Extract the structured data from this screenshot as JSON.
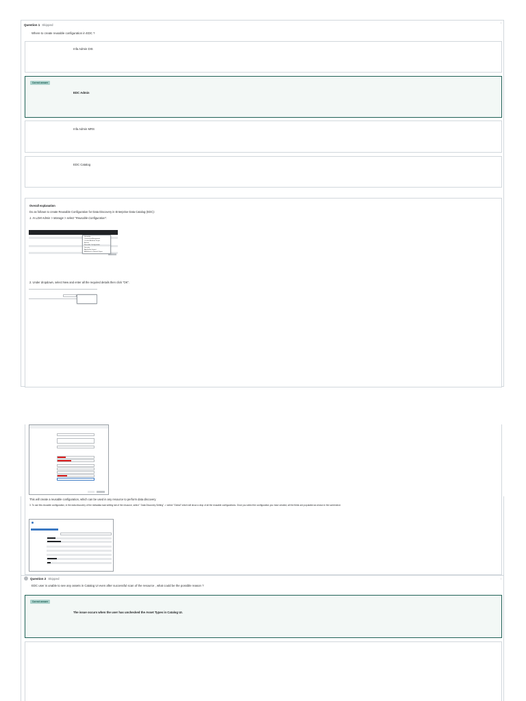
{
  "question1": {
    "number_label": "Question 1",
    "status": "Skipped",
    "text": "Where to create reusable configuration in EDC ?",
    "answers": [
      {
        "text": "Infa Admin DIS",
        "correct": false
      },
      {
        "text": "EDC Admin",
        "correct": true
      },
      {
        "text": "Infa Admin MRS",
        "correct": false
      },
      {
        "text": "EDC Catalog",
        "correct": false
      }
    ],
    "correct_badge": "Correct answer"
  },
  "explanation": {
    "heading": "Overall explanation",
    "line1": "Do as follows to create Reusable Configuration for Data Discovery in Enterprise Data Catalog (EDC):",
    "line2": "1. In LDM Admin > Manage > select \"Reusable Configuration\".",
    "step2": "2. Under dropdown, select New and enter all the required details then click \"OK\".",
    "menu_items": [
      "Schedule",
      "Connection Assignment",
      "Custom Attribute Scope",
      "Actions",
      "Reusable Configuration",
      "Security",
      "Application Import",
      "Add Asset to Default Object"
    ],
    "after_dialog": "This will create a reusable configuration, which can be used in any resource to perform data discovery",
    "step3": "3. To use this reusable configuration, in the data discovery of the metadata load setting tab of the resource, select \" Data Discovery Setting\" -> select \"Global\" which will show a drop of all the reusable configurations. Once you select the configuration you have created, all the fields are populated as shown in the screenshot."
  },
  "question2": {
    "number_label": "Question 2",
    "status": "Skipped",
    "text": "EDC user is unable to see any assets in Catalog UI even after successful scan of the resource , what could be the possible reason ?",
    "correct_badge": "Correct answer",
    "correct_text": "The issue occurs when the user has unchecked the Asset Types in Catalog UI."
  },
  "colors": {
    "correct_border": "#1e6055",
    "correct_badge_bg": "#acd2cc",
    "panel_border": "#d1d7dc"
  }
}
